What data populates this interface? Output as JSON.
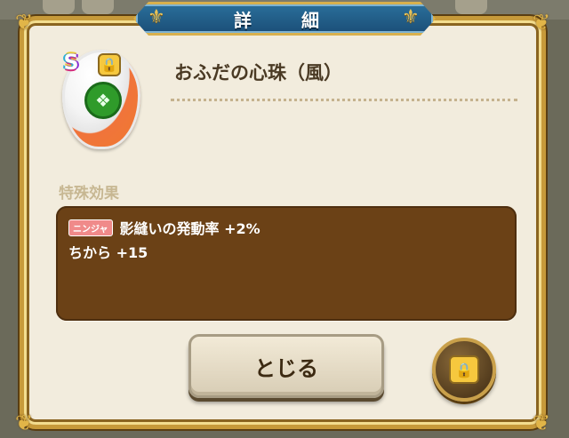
{
  "dialog": {
    "title": "詳　細"
  },
  "item": {
    "rank": "S",
    "name": "おふだの心珠（風）"
  },
  "effects": {
    "section_label": "特殊効果",
    "rows": [
      {
        "tag": "ニンジャ",
        "text": "影縫いの発動率 +2%"
      },
      {
        "tag": "",
        "text": "ちから +15"
      }
    ]
  },
  "buttons": {
    "close_label": "とじる"
  },
  "icons": {
    "emblem": "green-dragon-emblem-icon",
    "lock": "lock-icon",
    "fleur": "fleur-de-lis-icon"
  },
  "colors": {
    "panel_bg": "#f2ecdd",
    "title_bg": "#1b4f78",
    "effects_bg": "#6b4116",
    "job_tag": "#f08a8a"
  }
}
